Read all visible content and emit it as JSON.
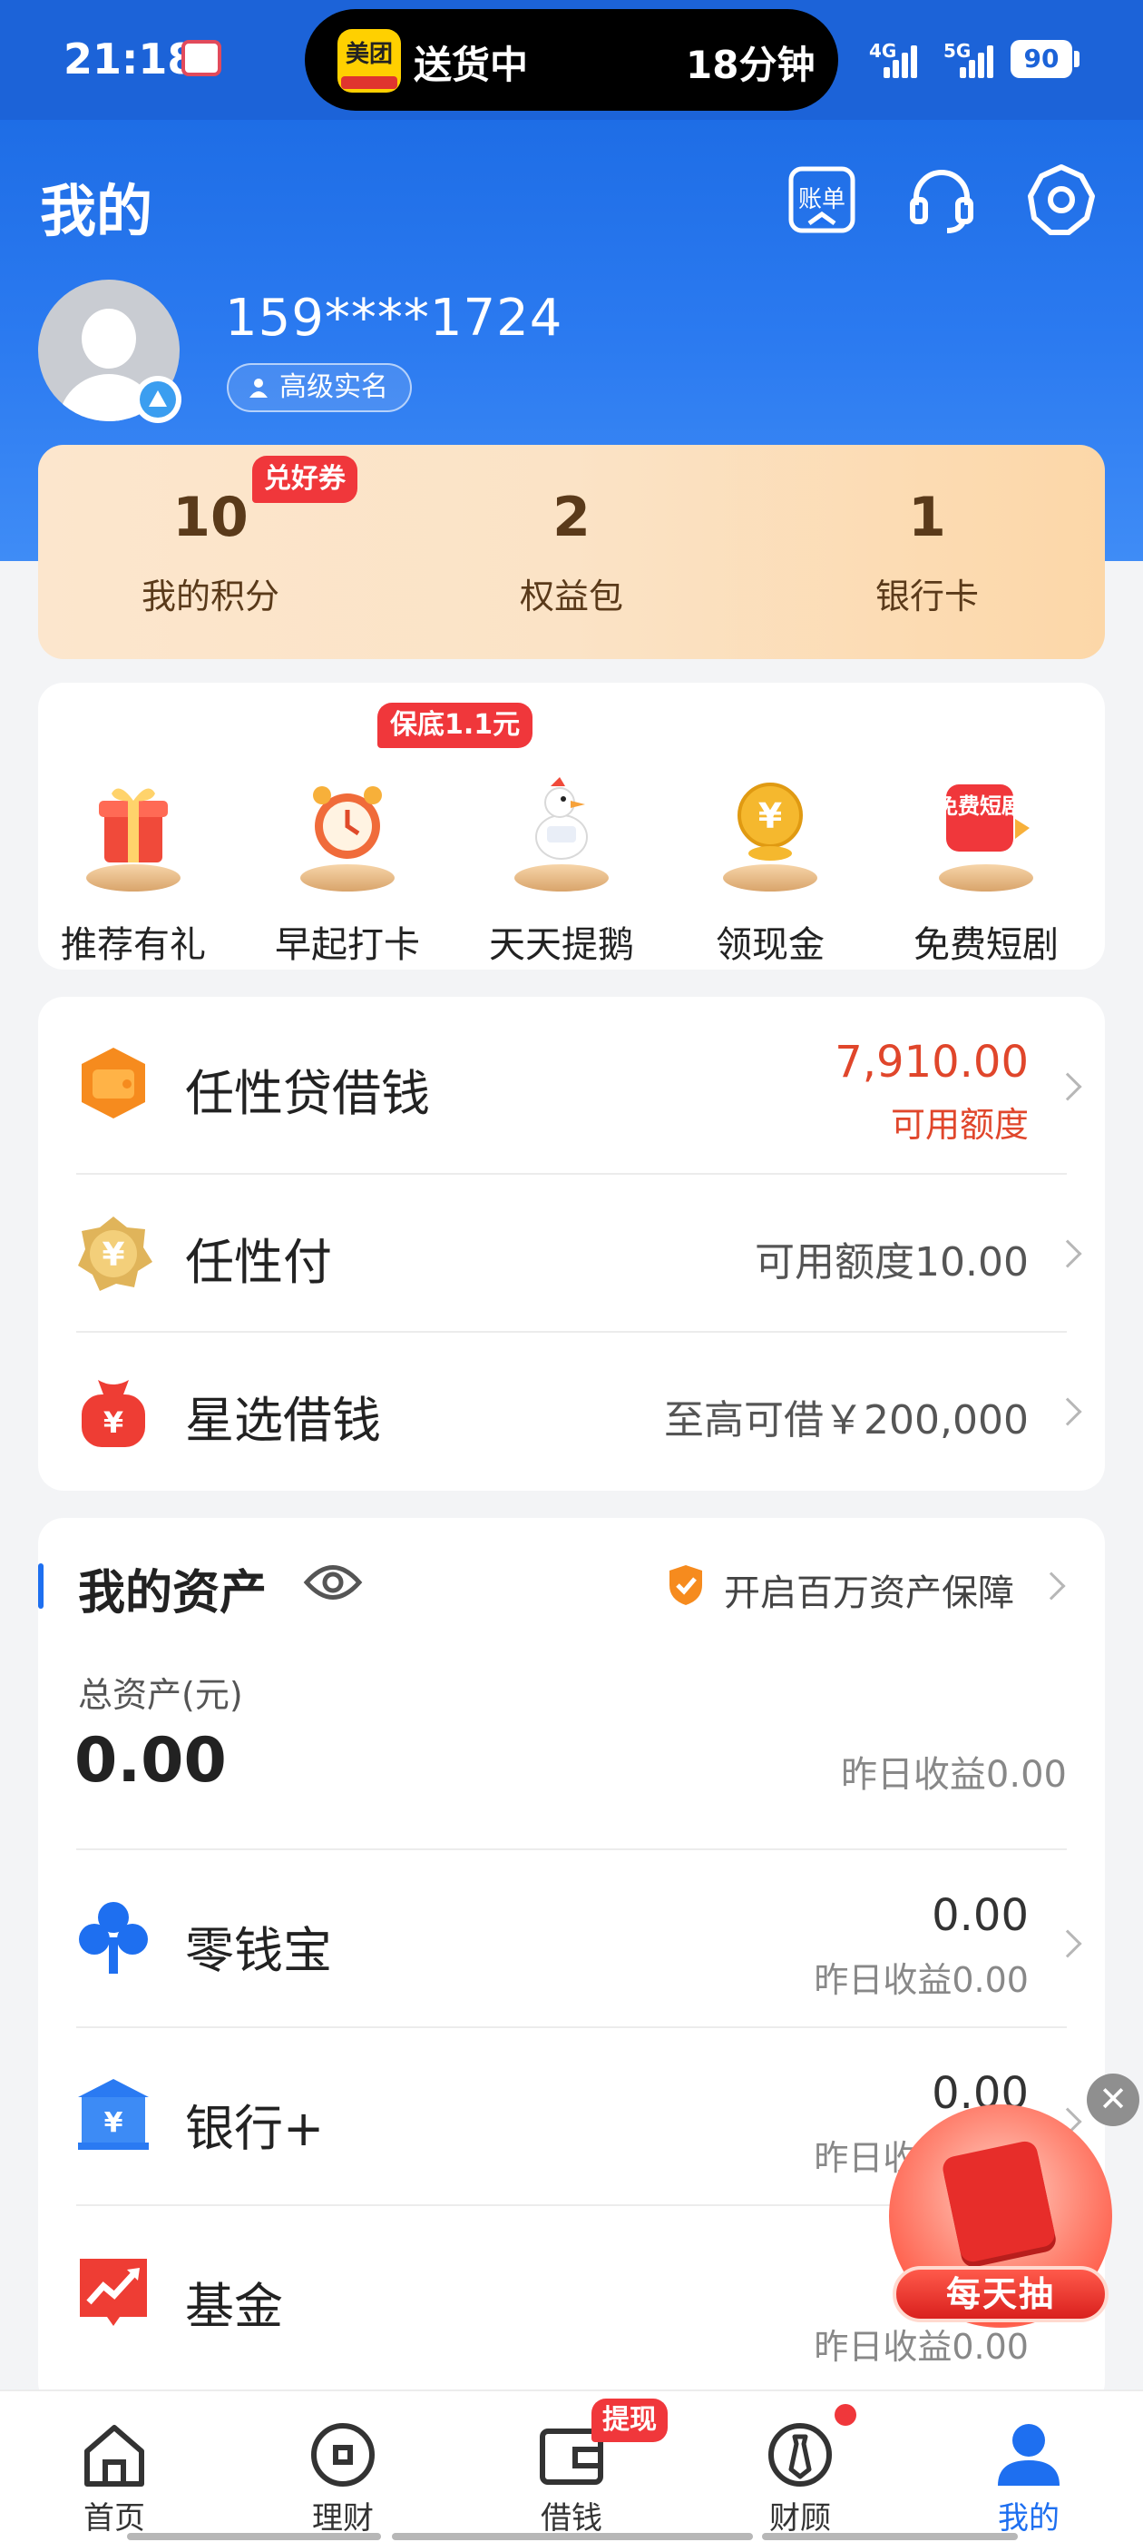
{
  "status_bar": {
    "time": "21:18",
    "island_app": "美团",
    "island_status": "送货中",
    "island_eta": "18分钟",
    "net_1": "4G",
    "net_2": "5G",
    "battery": "90"
  },
  "header": {
    "title": "我的",
    "bill_label": "账单",
    "phone": "159****1724",
    "verified_label": "高级实名"
  },
  "points": {
    "coupon_tag": "兑好券",
    "items": [
      {
        "value": "10",
        "label": "我的积分"
      },
      {
        "value": "2",
        "label": "权益包"
      },
      {
        "value": "1",
        "label": "银行卡"
      }
    ]
  },
  "activities": {
    "badge": "保底1.1元",
    "items": [
      {
        "label": "推荐有礼",
        "icon": "gift-icon"
      },
      {
        "label": "早起打卡",
        "icon": "alarm-clock-icon"
      },
      {
        "label": "天天提鹅",
        "icon": "goose-icon"
      },
      {
        "label": "领现金",
        "icon": "coin-icon"
      },
      {
        "label": "免费短剧",
        "icon": "short-drama-icon",
        "art_text": "免费短剧"
      }
    ]
  },
  "loans": {
    "rows": [
      {
        "title": "任性贷借钱",
        "value": "7,910.00",
        "sub": "可用额度"
      },
      {
        "title": "任性付",
        "value": "可用额度10.00"
      },
      {
        "title": "星选借钱",
        "value": "至高可借￥200,000"
      }
    ]
  },
  "assets": {
    "title": "我的资产",
    "protect_label": "开启百万资产保障",
    "total_label": "总资产(元)",
    "total_value": "0.00",
    "yesterday": "昨日收益0.00",
    "rows": [
      {
        "title": "零钱宝",
        "value": "0.00",
        "sub": "昨日收益0.00"
      },
      {
        "title": "银行+",
        "value": "0.00",
        "sub": "昨日收益0.00"
      },
      {
        "title": "基金",
        "value": "",
        "sub": "昨日收益0.00"
      }
    ]
  },
  "float_widget": {
    "label": "每天抽",
    "close": "✕"
  },
  "tabbar": {
    "badge": "提现",
    "items": [
      {
        "label": "首页"
      },
      {
        "label": "理财"
      },
      {
        "label": "借钱"
      },
      {
        "label": "财顾"
      },
      {
        "label": "我的"
      }
    ]
  },
  "colors": {
    "brand_blue": "#1e6ff0",
    "accent_red": "#f0373b",
    "loan_value": "#e0462b"
  }
}
